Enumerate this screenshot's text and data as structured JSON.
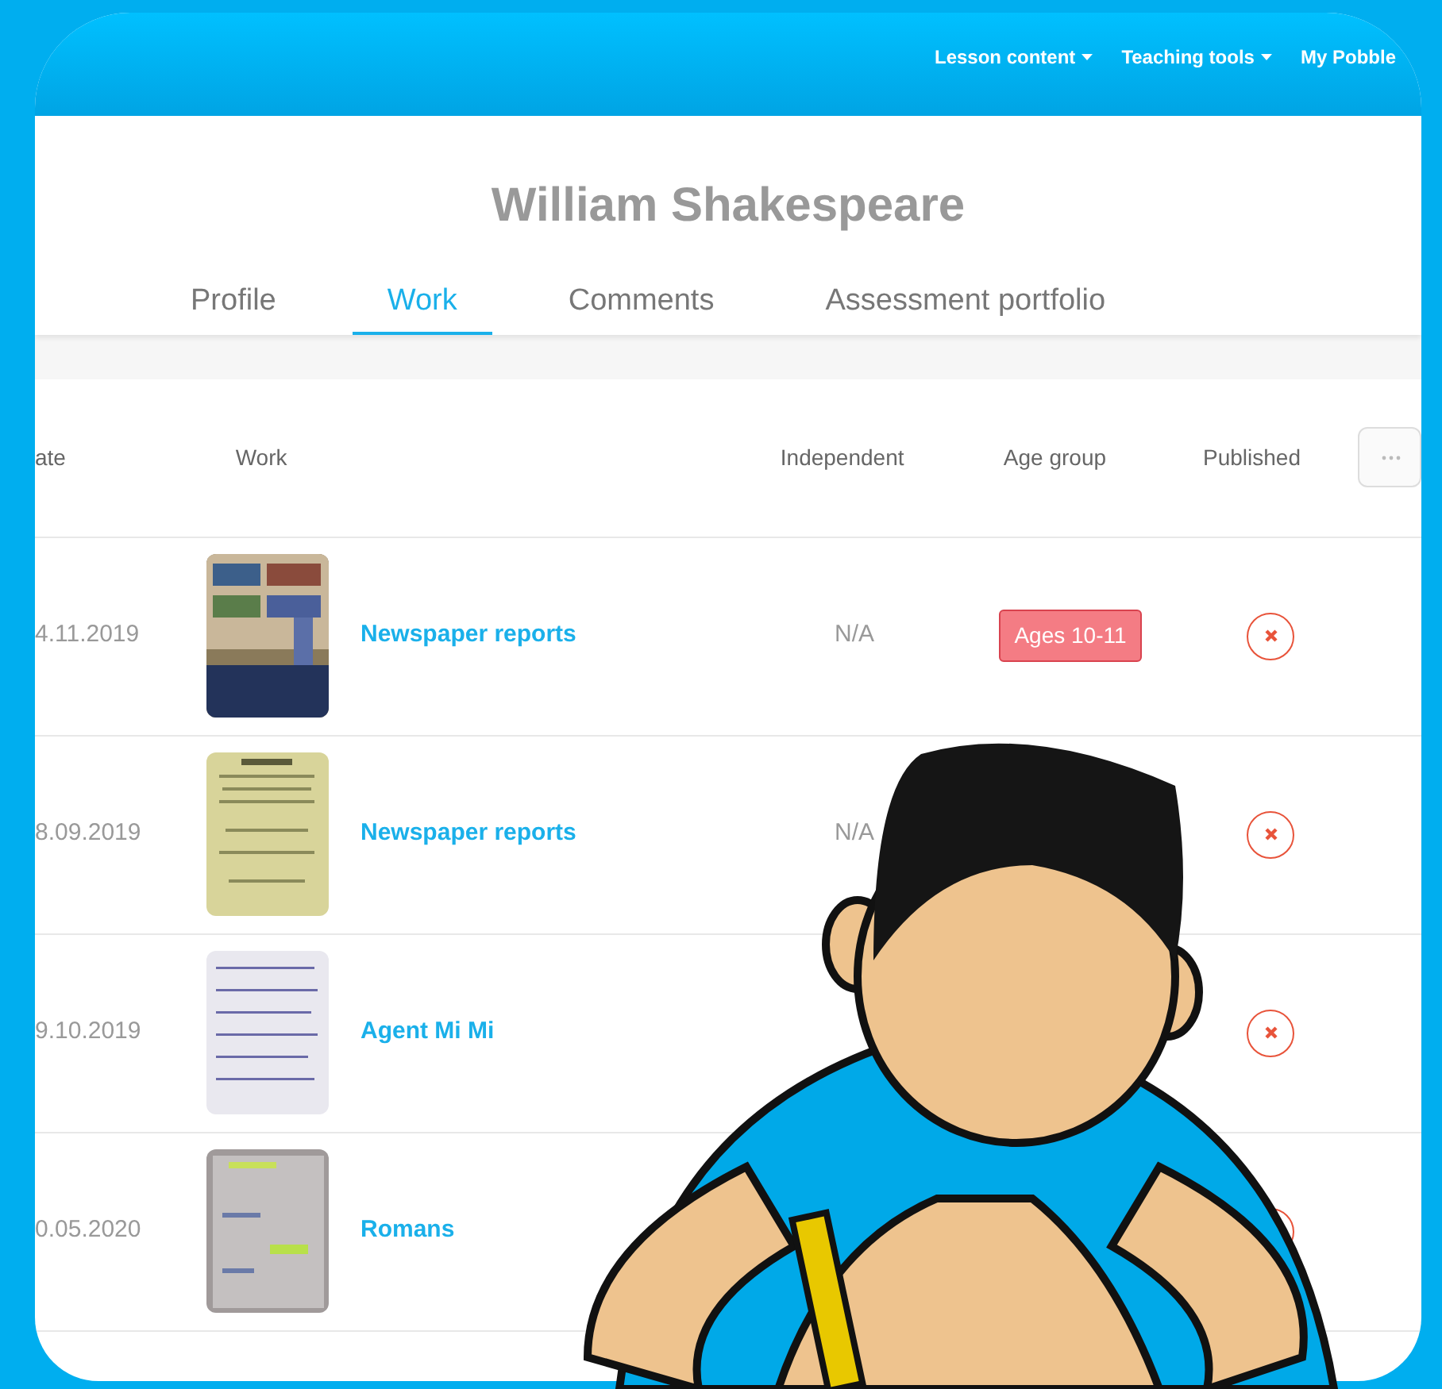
{
  "nav": [
    {
      "label": "Lesson content",
      "dropdown": true
    },
    {
      "label": "Teaching tools",
      "dropdown": true
    },
    {
      "label": "My Pobble",
      "dropdown": false
    }
  ],
  "title": "William Shakespeare",
  "tabs": [
    {
      "label": "Profile",
      "selected": false
    },
    {
      "label": "Work",
      "selected": true
    },
    {
      "label": "Comments",
      "selected": false
    },
    {
      "label": "Assessment portfolio",
      "selected": false
    }
  ],
  "table": {
    "columns": [
      "ate",
      "Work",
      "Independent",
      "Age group",
      "Published"
    ],
    "rows": [
      {
        "date": "4.11.2019",
        "title": "Newspaper reports",
        "independent": "N/A",
        "age_group": "Ages 10-11",
        "published": false
      },
      {
        "date": "8.09.2019",
        "title": "Newspaper reports",
        "independent": "N/A",
        "published": false
      },
      {
        "date": "9.10.2019",
        "title": "Agent Mi Mi",
        "published": false
      },
      {
        "date": "0.05.2020",
        "title": "Romans",
        "published": false
      }
    ]
  }
}
